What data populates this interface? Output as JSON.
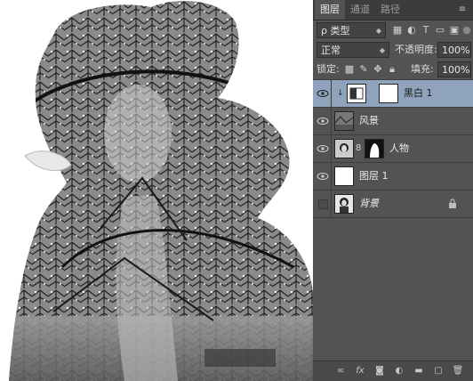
{
  "panel": {
    "tabs": [
      "图层",
      "通道",
      "路径"
    ],
    "active_tab": 0,
    "menu_icon": "panel-menu-icon",
    "filter": {
      "label": "ρ 类型",
      "icons": [
        "pixel-filter-icon",
        "adjustment-filter-icon",
        "type-filter-icon",
        "shape-filter-icon",
        "smart-object-filter-icon"
      ]
    },
    "blend_mode": "正常",
    "opacity_label": "不透明度:",
    "opacity_value": "100%",
    "lock_label": "锁定:",
    "lock_icons": [
      "lock-transparent-icon",
      "lock-pixels-icon",
      "lock-position-icon",
      "lock-all-icon"
    ],
    "fill_label": "填充:",
    "fill_value": "100%",
    "layers": [
      {
        "name": "黑白 1",
        "selected": true,
        "visible": true,
        "kind": "adjustment"
      },
      {
        "name": "风景",
        "selected": false,
        "visible": true,
        "kind": "image"
      },
      {
        "name": "人物",
        "selected": false,
        "visible": true,
        "kind": "masked"
      },
      {
        "name": "图层 1",
        "selected": false,
        "visible": true,
        "kind": "white"
      },
      {
        "name": "背景",
        "selected": false,
        "visible": false,
        "kind": "background",
        "locked": true
      }
    ],
    "footer_icons": [
      "link-layers-icon",
      "fx-icon",
      "add-mask-icon",
      "adjustment-layer-icon",
      "new-group-icon",
      "new-layer-icon",
      "delete-layer-icon"
    ]
  },
  "colors": {
    "panel_bg": "#535353",
    "selected_layer": "#8fa3bd",
    "tab_bar": "#3c3c3c"
  }
}
